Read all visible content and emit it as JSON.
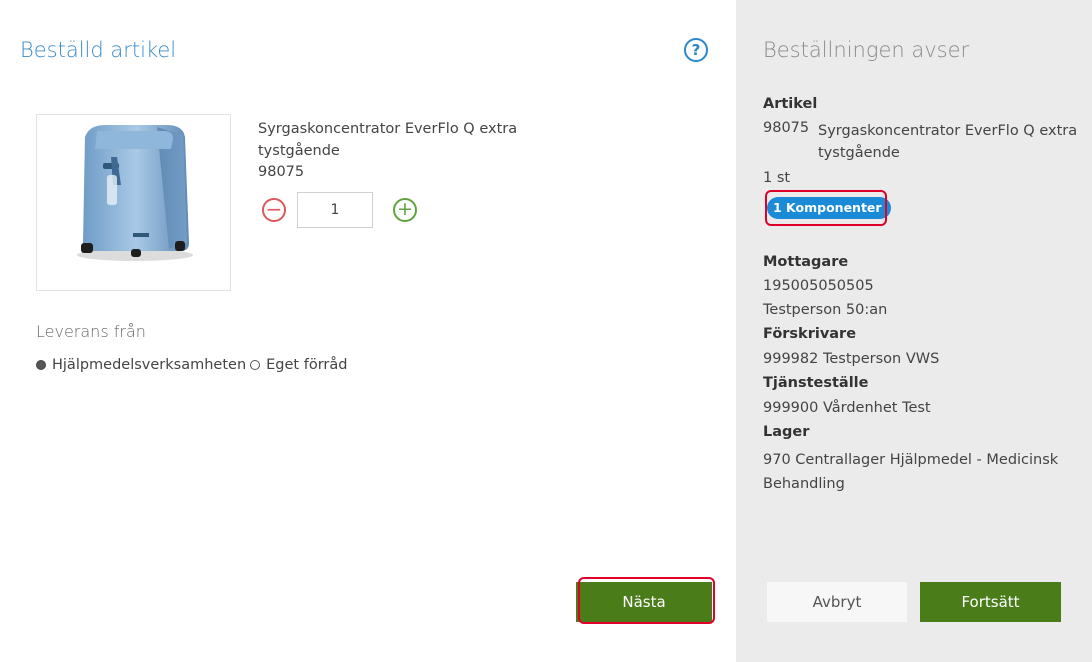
{
  "left": {
    "title": "Beställd artikel",
    "help_glyph": "?",
    "product": {
      "name": "Syrgaskoncentrator EverFlo Q extra tystgående",
      "code": "98075",
      "quantity": "1",
      "minus_glyph": "−",
      "plus_glyph": "+"
    },
    "delivery": {
      "title": "Leverans från",
      "options": [
        {
          "label": "Hjälpmedelsverksamheten",
          "selected": true
        },
        {
          "label": "Eget förråd",
          "selected": false
        }
      ]
    },
    "next_button": "Nästa"
  },
  "right": {
    "title": "Beställningen avser",
    "article_label": "Artikel",
    "article_code": "98075",
    "article_name": "Syrgaskoncentrator EverFlo Q extra tystgående",
    "article_qty": "1 st",
    "components_badge": "1 Komponenter",
    "recipient_label": "Mottagare",
    "recipient_id": "195005050505",
    "recipient_name": "Testperson 50:an",
    "prescriber_label": "Förskrivare",
    "prescriber": "999982 Testperson VWS",
    "unit_label": "Tjänsteställe",
    "unit": "999900 Vårdenhet Test",
    "stock_label": "Lager",
    "stock": "970 Centrallager Hjälpmedel - Medicinsk Behandling",
    "cancel_button": "Avbryt",
    "continue_button": "Fortsätt"
  },
  "colors": {
    "accent_blue": "#3a8dc8",
    "badge_blue": "#1b8bd8",
    "button_green": "#4a7d1a",
    "minus_red": "#e0565b",
    "plus_green": "#5fa33e",
    "highlight_red": "#e0002a",
    "sidebar_bg": "#ebebeb"
  },
  "icons": [
    "help-icon",
    "minus-icon",
    "plus-icon",
    "product-image"
  ]
}
